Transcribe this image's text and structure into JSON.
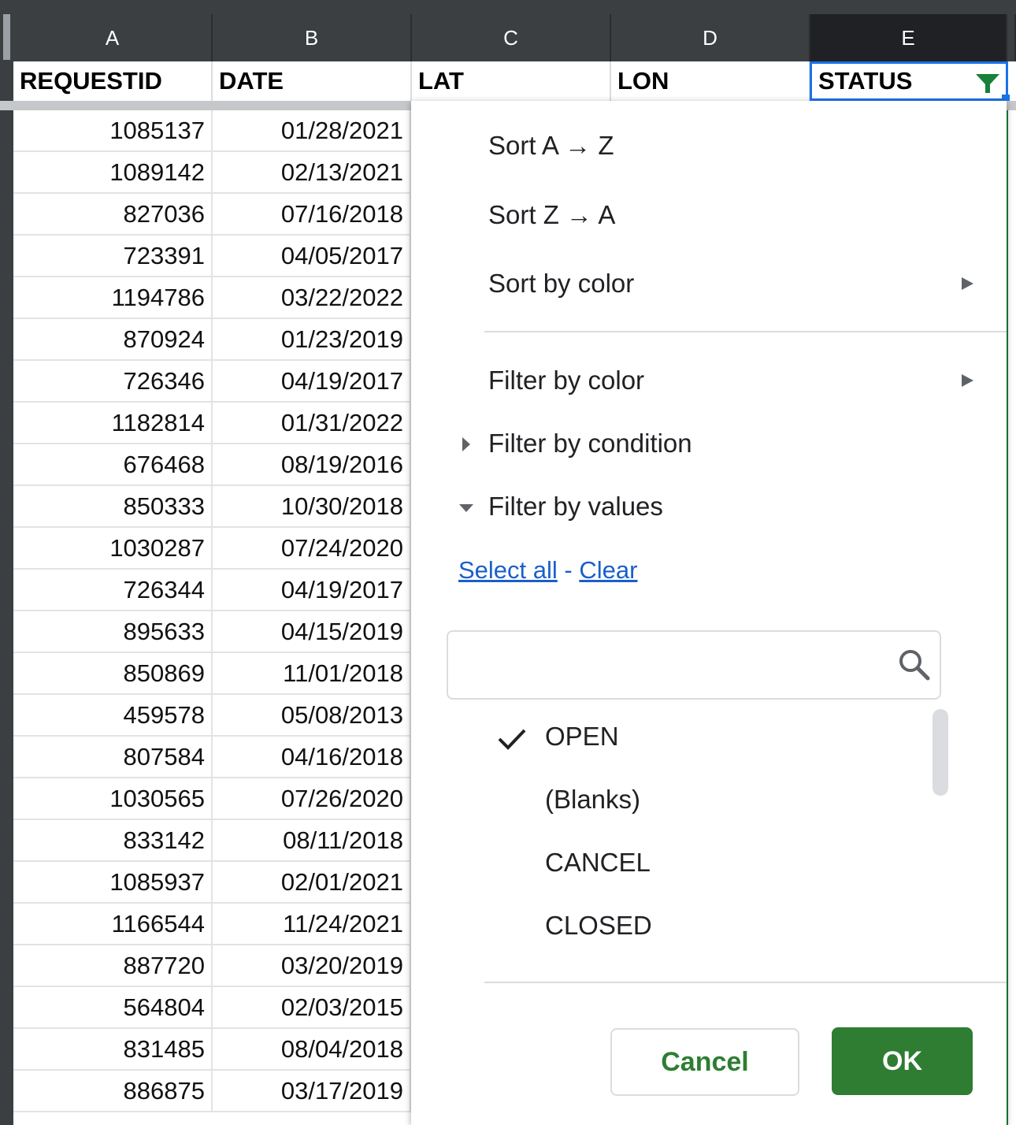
{
  "columns": [
    "A",
    "B",
    "C",
    "D",
    "E"
  ],
  "headers": {
    "a": "REQUESTID",
    "b": "DATE",
    "c": "LAT",
    "d": "LON",
    "e": "STATUS"
  },
  "rows": [
    {
      "id": "1085137",
      "date": "01/28/2021"
    },
    {
      "id": "1089142",
      "date": "02/13/2021"
    },
    {
      "id": "827036",
      "date": "07/16/2018"
    },
    {
      "id": "723391",
      "date": "04/05/2017"
    },
    {
      "id": "1194786",
      "date": "03/22/2022"
    },
    {
      "id": "870924",
      "date": "01/23/2019"
    },
    {
      "id": "726346",
      "date": "04/19/2017"
    },
    {
      "id": "1182814",
      "date": "01/31/2022"
    },
    {
      "id": "676468",
      "date": "08/19/2016"
    },
    {
      "id": "850333",
      "date": "10/30/2018"
    },
    {
      "id": "1030287",
      "date": "07/24/2020"
    },
    {
      "id": "726344",
      "date": "04/19/2017"
    },
    {
      "id": "895633",
      "date": "04/15/2019"
    },
    {
      "id": "850869",
      "date": "11/01/2018"
    },
    {
      "id": "459578",
      "date": "05/08/2013"
    },
    {
      "id": "807584",
      "date": "04/16/2018"
    },
    {
      "id": "1030565",
      "date": "07/26/2020"
    },
    {
      "id": "833142",
      "date": "08/11/2018"
    },
    {
      "id": "1085937",
      "date": "02/01/2021"
    },
    {
      "id": "1166544",
      "date": "11/24/2021"
    },
    {
      "id": "887720",
      "date": "03/20/2019"
    },
    {
      "id": "564804",
      "date": "02/03/2015"
    },
    {
      "id": "831485",
      "date": "08/04/2018"
    },
    {
      "id": "886875",
      "date": "03/17/2019"
    }
  ],
  "menu": {
    "sort_az": "Sort A → Z",
    "sort_za": "Sort Z → A",
    "sort_by_color": "Sort by color",
    "filter_by_color": "Filter by color",
    "filter_by_condition": "Filter by condition",
    "filter_by_values": "Filter by values",
    "select_all": "Select all",
    "separator": " - ",
    "clear": "Clear",
    "search_value": "",
    "values": [
      {
        "label": "OPEN",
        "checked": true
      },
      {
        "label": "(Blanks)",
        "checked": false
      },
      {
        "label": "CANCEL",
        "checked": false
      },
      {
        "label": "CLOSED",
        "checked": false
      }
    ],
    "cancel": "Cancel",
    "ok": "OK"
  },
  "colors": {
    "accent_green": "#2e7d32",
    "link_blue": "#1a5fc9",
    "selection_blue": "#1a73e8"
  }
}
